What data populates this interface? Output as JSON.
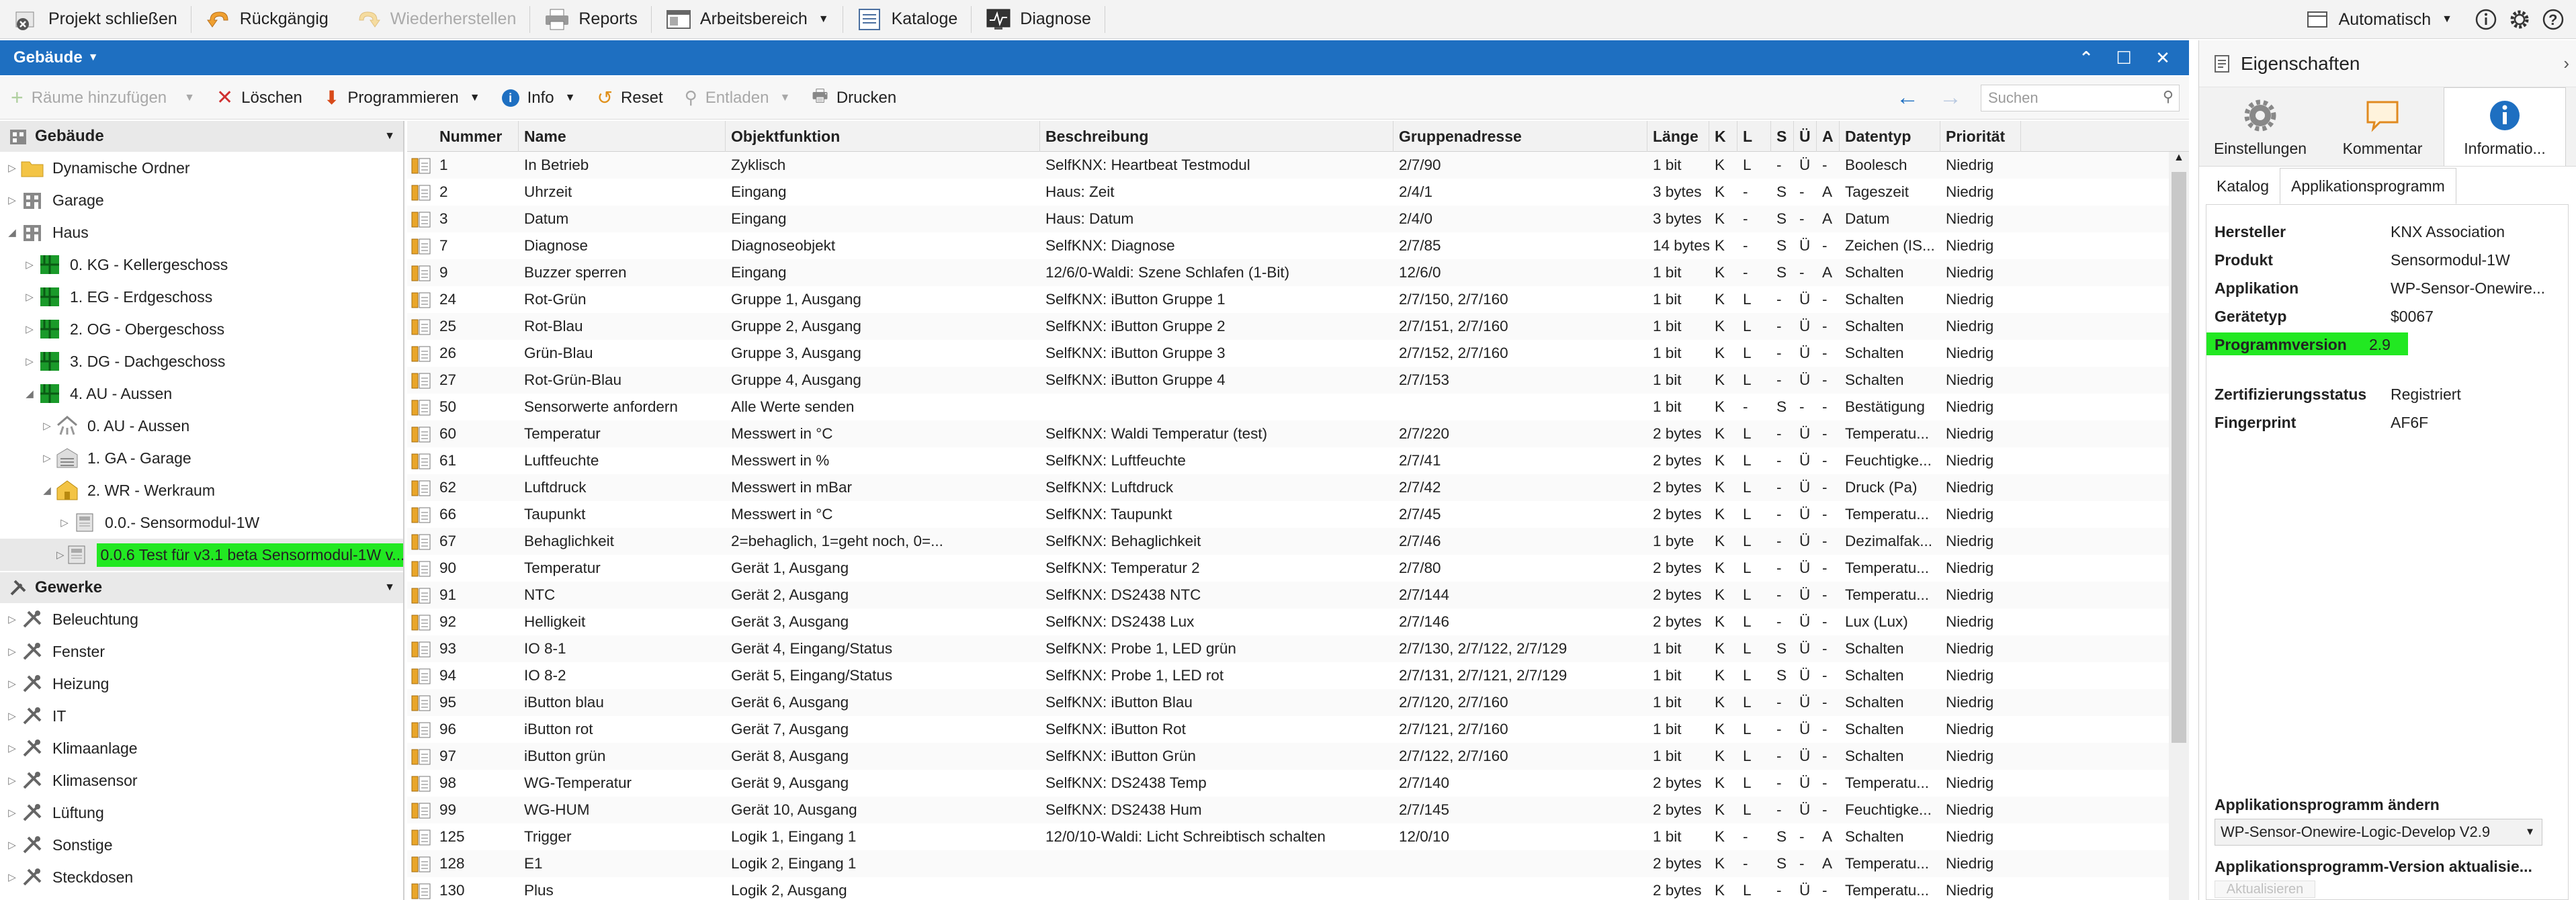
{
  "toolbar": {
    "items": [
      {
        "label": "Projekt schließen",
        "icon": "close-project-icon"
      },
      {
        "label": "Rückgängig",
        "icon": "undo-icon"
      },
      {
        "label": "Wiederherstellen",
        "icon": "redo-icon"
      },
      {
        "label": "Reports",
        "icon": "printer-icon"
      },
      {
        "label": "Arbeitsbereich",
        "icon": "workspace-icon"
      },
      {
        "label": "Kataloge",
        "icon": "catalog-icon"
      },
      {
        "label": "Diagnose",
        "icon": "diagnose-icon"
      }
    ],
    "mode_label": "Automatisch"
  },
  "panel": {
    "title": "Gebäude"
  },
  "actions": {
    "add_rooms": "Räume hinzufügen",
    "delete": "Löschen",
    "program": "Programmieren",
    "info": "Info",
    "reset": "Reset",
    "unload": "Entladen",
    "print": "Drucken",
    "search_placeholder": "Suchen"
  },
  "tree": {
    "building_header": "Gebäude",
    "building_nodes": [
      {
        "label": "Dynamische Ordner",
        "level": 0,
        "icon": "folder-icon"
      },
      {
        "label": "Garage",
        "level": 0,
        "icon": "building-icon"
      },
      {
        "label": "Haus",
        "level": 0,
        "icon": "building-icon",
        "expanded": true
      },
      {
        "label": "0. KG - Kellergeschoss",
        "level": 1,
        "icon": "floor-icon"
      },
      {
        "label": "1. EG - Erdgeschoss",
        "level": 1,
        "icon": "floor-icon"
      },
      {
        "label": "2. OG - Obergeschoss",
        "level": 1,
        "icon": "floor-icon"
      },
      {
        "label": "3. DG - Dachgeschoss",
        "level": 1,
        "icon": "floor-icon"
      },
      {
        "label": "4. AU - Aussen",
        "level": 1,
        "icon": "floor-icon",
        "expanded": true
      },
      {
        "label": "0. AU - Aussen",
        "level": 2,
        "icon": "outdoor-icon"
      },
      {
        "label": "1. GA - Garage",
        "level": 2,
        "icon": "garage-icon"
      },
      {
        "label": "2. WR - Werkraum",
        "level": 2,
        "icon": "room-icon",
        "expanded": true
      },
      {
        "label": "0.0.- Sensormodul-1W",
        "level": 3,
        "icon": "device-icon"
      },
      {
        "label": "0.0.6 Test für v3.1 beta Sensormodul-1W v...",
        "level": 3,
        "icon": "device-icon",
        "highlight": true
      }
    ],
    "trades_header": "Gewerke",
    "trade_nodes": [
      "Beleuchtung",
      "Fenster",
      "Heizung",
      "IT",
      "Klimaanlage",
      "Klimasensor",
      "Lüftung",
      "Sonstige",
      "Steckdosen"
    ]
  },
  "table": {
    "columns": [
      "Nummer",
      "Name",
      "Objektfunktion",
      "Beschreibung",
      "Gruppenadresse",
      "Länge",
      "K",
      "L",
      "S",
      "Ü",
      "A",
      "Datentyp",
      "Priorität"
    ],
    "rows": [
      [
        "1",
        "In Betrieb",
        "Zyklisch",
        "SelfKNX: Heartbeat Testmodul",
        "2/7/90",
        "1 bit",
        "K",
        "L",
        "-",
        "Ü",
        "-",
        "Boolesch",
        "Niedrig"
      ],
      [
        "2",
        "Uhrzeit",
        "Eingang",
        "Haus: Zeit",
        "2/4/1",
        "3 bytes",
        "K",
        "-",
        "S",
        "-",
        "A",
        "Tageszeit",
        "Niedrig"
      ],
      [
        "3",
        "Datum",
        "Eingang",
        "Haus: Datum",
        "2/4/0",
        "3 bytes",
        "K",
        "-",
        "S",
        "-",
        "A",
        "Datum",
        "Niedrig"
      ],
      [
        "7",
        "Diagnose",
        "Diagnoseobjekt",
        "SelfKNX: Diagnose",
        "2/7/85",
        "14 bytes",
        "K",
        "-",
        "S",
        "Ü",
        "-",
        "Zeichen (IS...",
        "Niedrig"
      ],
      [
        "9",
        "Buzzer sperren",
        "Eingang",
        "12/6/0-Waldi: Szene Schlafen (1-Bit)",
        "12/6/0",
        "1 bit",
        "K",
        "-",
        "S",
        "-",
        "A",
        "Schalten",
        "Niedrig"
      ],
      [
        "24",
        "Rot-Grün",
        "Gruppe 1, Ausgang",
        "SelfKNX: iButton Gruppe 1",
        "2/7/150, 2/7/160",
        "1 bit",
        "K",
        "L",
        "-",
        "Ü",
        "-",
        "Schalten",
        "Niedrig"
      ],
      [
        "25",
        "Rot-Blau",
        "Gruppe 2, Ausgang",
        "SelfKNX: iButton Gruppe 2",
        "2/7/151, 2/7/160",
        "1 bit",
        "K",
        "L",
        "-",
        "Ü",
        "-",
        "Schalten",
        "Niedrig"
      ],
      [
        "26",
        "Grün-Blau",
        "Gruppe 3, Ausgang",
        "SelfKNX: iButton Gruppe 3",
        "2/7/152, 2/7/160",
        "1 bit",
        "K",
        "L",
        "-",
        "Ü",
        "-",
        "Schalten",
        "Niedrig"
      ],
      [
        "27",
        "Rot-Grün-Blau",
        "Gruppe 4, Ausgang",
        "SelfKNX: iButton Gruppe 4",
        "2/7/153",
        "1 bit",
        "K",
        "L",
        "-",
        "Ü",
        "-",
        "Schalten",
        "Niedrig"
      ],
      [
        "50",
        "Sensorwerte anfordern",
        "Alle Werte senden",
        "",
        "",
        "1 bit",
        "K",
        "-",
        "S",
        "-",
        "-",
        "Bestätigung",
        "Niedrig"
      ],
      [
        "60",
        "Temperatur",
        "Messwert in °C",
        "SelfKNX: Waldi Temperatur (test)",
        "2/7/220",
        "2 bytes",
        "K",
        "L",
        "-",
        "Ü",
        "-",
        "Temperatu...",
        "Niedrig"
      ],
      [
        "61",
        "Luftfeuchte",
        "Messwert in %",
        "SelfKNX: Luftfeuchte",
        "2/7/41",
        "2 bytes",
        "K",
        "L",
        "-",
        "Ü",
        "-",
        "Feuchtigke...",
        "Niedrig"
      ],
      [
        "62",
        "Luftdruck",
        "Messwert in mBar",
        "SelfKNX: Luftdruck",
        "2/7/42",
        "2 bytes",
        "K",
        "L",
        "-",
        "Ü",
        "-",
        "Druck (Pa)",
        "Niedrig"
      ],
      [
        "66",
        "Taupunkt",
        "Messwert in °C",
        "SelfKNX: Taupunkt",
        "2/7/45",
        "2 bytes",
        "K",
        "L",
        "-",
        "Ü",
        "-",
        "Temperatu...",
        "Niedrig"
      ],
      [
        "67",
        "Behaglichkeit",
        "2=behaglich, 1=geht noch, 0=...",
        "SelfKNX: Behaglichkeit",
        "2/7/46",
        "1 byte",
        "K",
        "L",
        "-",
        "Ü",
        "-",
        "Dezimalfak...",
        "Niedrig"
      ],
      [
        "90",
        "Temperatur",
        "Gerät 1, Ausgang",
        "SelfKNX: Temperatur 2",
        "2/7/80",
        "2 bytes",
        "K",
        "L",
        "-",
        "Ü",
        "-",
        "Temperatu...",
        "Niedrig"
      ],
      [
        "91",
        "NTC",
        "Gerät 2, Ausgang",
        "SelfKNX: DS2438 NTC",
        "2/7/144",
        "2 bytes",
        "K",
        "L",
        "-",
        "Ü",
        "-",
        "Temperatu...",
        "Niedrig"
      ],
      [
        "92",
        "Helligkeit",
        "Gerät 3, Ausgang",
        "SelfKNX: DS2438 Lux",
        "2/7/146",
        "2 bytes",
        "K",
        "L",
        "-",
        "Ü",
        "-",
        "Lux (Lux)",
        "Niedrig"
      ],
      [
        "93",
        "IO 8-1",
        "Gerät 4, Eingang/Status",
        "SelfKNX: Probe 1, LED grün",
        "2/7/130, 2/7/122, 2/7/129",
        "1 bit",
        "K",
        "L",
        "S",
        "Ü",
        "-",
        "Schalten",
        "Niedrig"
      ],
      [
        "94",
        "IO 8-2",
        "Gerät 5, Eingang/Status",
        "SelfKNX: Probe 1, LED rot",
        "2/7/131, 2/7/121, 2/7/129",
        "1 bit",
        "K",
        "L",
        "S",
        "Ü",
        "-",
        "Schalten",
        "Niedrig"
      ],
      [
        "95",
        "iButton blau",
        "Gerät 6, Ausgang",
        "SelfKNX: iButton Blau",
        "2/7/120, 2/7/160",
        "1 bit",
        "K",
        "L",
        "-",
        "Ü",
        "-",
        "Schalten",
        "Niedrig"
      ],
      [
        "96",
        "iButton rot",
        "Gerät 7, Ausgang",
        "SelfKNX: iButton Rot",
        "2/7/121, 2/7/160",
        "1 bit",
        "K",
        "L",
        "-",
        "Ü",
        "-",
        "Schalten",
        "Niedrig"
      ],
      [
        "97",
        "iButton grün",
        "Gerät 8, Ausgang",
        "SelfKNX: iButton Grün",
        "2/7/122, 2/7/160",
        "1 bit",
        "K",
        "L",
        "-",
        "Ü",
        "-",
        "Schalten",
        "Niedrig"
      ],
      [
        "98",
        "WG-Temperatur",
        "Gerät 9, Ausgang",
        "SelfKNX: DS2438 Temp",
        "2/7/140",
        "2 bytes",
        "K",
        "L",
        "-",
        "Ü",
        "-",
        "Temperatu...",
        "Niedrig"
      ],
      [
        "99",
        "WG-HUM",
        "Gerät 10, Ausgang",
        "SelfKNX: DS2438 Hum",
        "2/7/145",
        "2 bytes",
        "K",
        "L",
        "-",
        "Ü",
        "-",
        "Feuchtigke...",
        "Niedrig"
      ],
      [
        "125",
        "Trigger",
        "Logik 1, Eingang 1",
        "12/0/10-Waldi: Licht Schreibtisch schalten",
        "12/0/10",
        "1 bit",
        "K",
        "-",
        "S",
        "-",
        "A",
        "Schalten",
        "Niedrig"
      ],
      [
        "128",
        "E1",
        "Logik 2, Eingang 1",
        "",
        "",
        "2 bytes",
        "K",
        "-",
        "S",
        "-",
        "A",
        "Temperatu...",
        "Niedrig"
      ],
      [
        "130",
        "Plus",
        "Logik 2, Ausgang",
        "",
        "",
        "2 bytes",
        "K",
        "L",
        "-",
        "Ü",
        "-",
        "Temperatu...",
        "Niedrig"
      ]
    ]
  },
  "properties": {
    "title": "Eigenschaften",
    "tabs": [
      "Einstellungen",
      "Kommentar",
      "Informatio..."
    ],
    "subtabs": [
      "Katalog",
      "Applikationsprogramm"
    ],
    "fields": [
      {
        "key": "Hersteller",
        "value": "KNX Association"
      },
      {
        "key": "Produkt",
        "value": "Sensormodul-1W"
      },
      {
        "key": "Applikation",
        "value": "WP-Sensor-Onewire..."
      },
      {
        "key": "Gerätetyp",
        "value": "$0067"
      },
      {
        "key": "Programmversion",
        "value": "2.9",
        "highlight": true
      },
      {
        "key": "Zertifizierungsstatus",
        "value": "Registriert"
      },
      {
        "key": "Fingerprint",
        "value": "AF6F"
      }
    ],
    "change_label": "Applikationsprogramm ändern",
    "change_value": "WP-Sensor-Onewire-Logic-Develop V2.9",
    "update_label": "Applikationsprogramm-Version aktualisie...",
    "update_button": "Aktualisieren"
  },
  "colors": {
    "accent": "#1e6fc1",
    "highlight": "#22e822"
  }
}
